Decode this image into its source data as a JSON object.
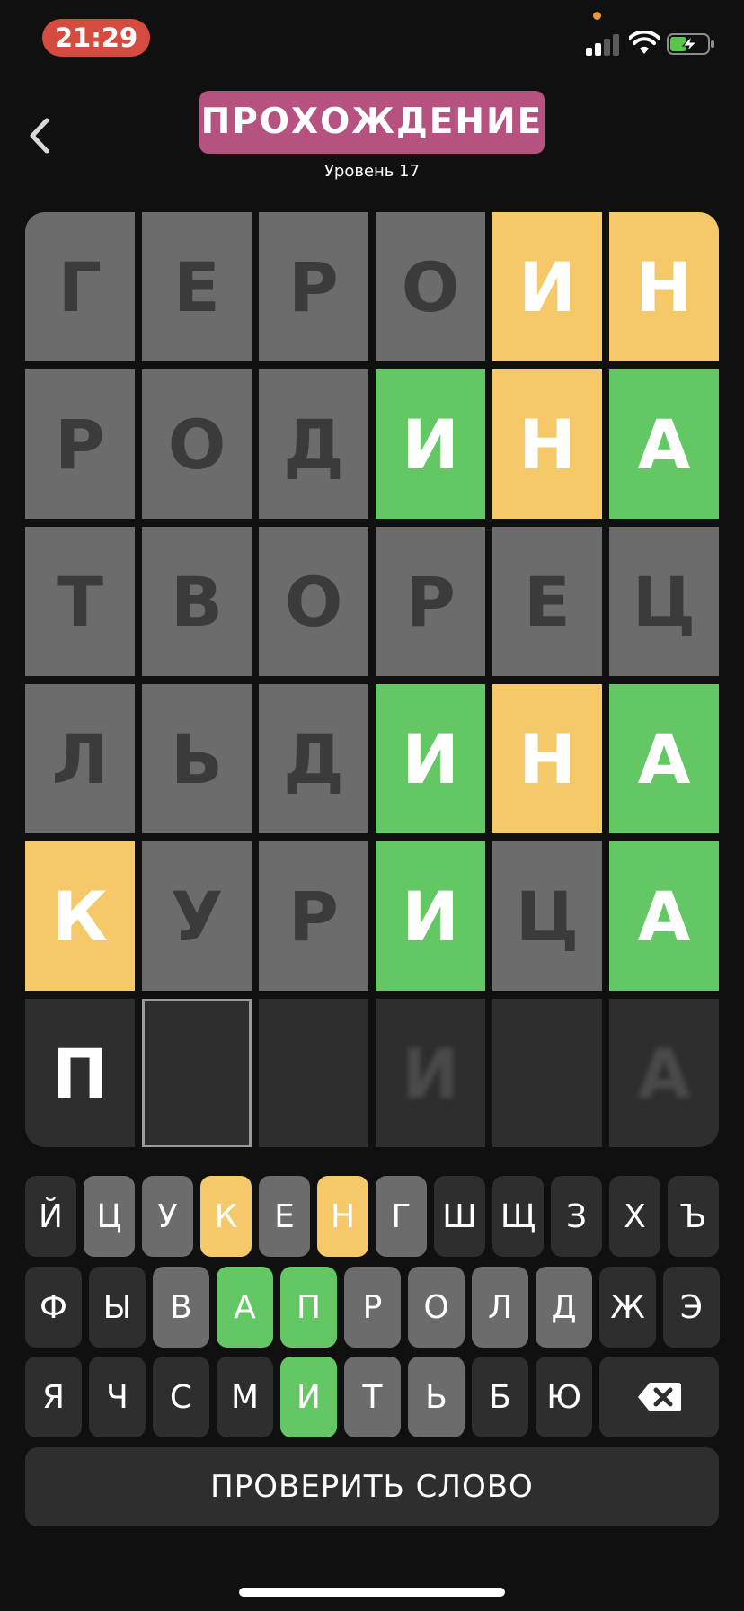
{
  "status": {
    "time": "21:29"
  },
  "header": {
    "title": "ПРОХОЖДЕНИЕ",
    "subtitle": "Уровень 17"
  },
  "colors": {
    "gray": "#6c6c6c",
    "yellow": "#f5c96a",
    "green": "#63c864",
    "empty": "#2e2e2e",
    "title_bg": "#b6527f"
  },
  "icons": {
    "back": "chevron-left-icon",
    "backspace": "backspace-icon"
  },
  "board": {
    "rows": [
      [
        {
          "letter": "Г",
          "state": "gray"
        },
        {
          "letter": "Е",
          "state": "gray"
        },
        {
          "letter": "Р",
          "state": "gray"
        },
        {
          "letter": "О",
          "state": "gray"
        },
        {
          "letter": "И",
          "state": "yellow"
        },
        {
          "letter": "Н",
          "state": "yellow"
        }
      ],
      [
        {
          "letter": "Р",
          "state": "gray"
        },
        {
          "letter": "О",
          "state": "gray"
        },
        {
          "letter": "Д",
          "state": "gray"
        },
        {
          "letter": "И",
          "state": "green"
        },
        {
          "letter": "Н",
          "state": "yellow"
        },
        {
          "letter": "А",
          "state": "green"
        }
      ],
      [
        {
          "letter": "Т",
          "state": "gray"
        },
        {
          "letter": "В",
          "state": "gray"
        },
        {
          "letter": "О",
          "state": "gray"
        },
        {
          "letter": "Р",
          "state": "gray"
        },
        {
          "letter": "Е",
          "state": "gray"
        },
        {
          "letter": "Ц",
          "state": "gray"
        }
      ],
      [
        {
          "letter": "Л",
          "state": "gray"
        },
        {
          "letter": "Ь",
          "state": "gray"
        },
        {
          "letter": "Д",
          "state": "gray"
        },
        {
          "letter": "И",
          "state": "green"
        },
        {
          "letter": "Н",
          "state": "yellow"
        },
        {
          "letter": "А",
          "state": "green"
        }
      ],
      [
        {
          "letter": "К",
          "state": "yellow"
        },
        {
          "letter": "У",
          "state": "gray"
        },
        {
          "letter": "Р",
          "state": "gray"
        },
        {
          "letter": "И",
          "state": "green"
        },
        {
          "letter": "Ц",
          "state": "gray"
        },
        {
          "letter": "А",
          "state": "green"
        }
      ],
      [
        {
          "letter": "П",
          "state": "empty"
        },
        {
          "letter": "",
          "state": "cursor"
        },
        {
          "letter": "",
          "state": "empty"
        },
        {
          "letter": "И",
          "state": "hint"
        },
        {
          "letter": "",
          "state": "empty"
        },
        {
          "letter": "А",
          "state": "hint"
        }
      ]
    ]
  },
  "keyboard": {
    "rows": [
      [
        {
          "k": "Й",
          "s": "dark"
        },
        {
          "k": "Ц",
          "s": "gray"
        },
        {
          "k": "У",
          "s": "gray"
        },
        {
          "k": "К",
          "s": "yellow"
        },
        {
          "k": "Е",
          "s": "gray"
        },
        {
          "k": "Н",
          "s": "yellow"
        },
        {
          "k": "Г",
          "s": "gray"
        },
        {
          "k": "Ш",
          "s": "dark"
        },
        {
          "k": "Щ",
          "s": "dark"
        },
        {
          "k": "З",
          "s": "dark"
        },
        {
          "k": "Х",
          "s": "dark"
        },
        {
          "k": "Ъ",
          "s": "dark"
        }
      ],
      [
        {
          "k": "Ф",
          "s": "dark"
        },
        {
          "k": "Ы",
          "s": "dark"
        },
        {
          "k": "В",
          "s": "gray"
        },
        {
          "k": "А",
          "s": "green"
        },
        {
          "k": "П",
          "s": "green"
        },
        {
          "k": "Р",
          "s": "gray"
        },
        {
          "k": "О",
          "s": "gray"
        },
        {
          "k": "Л",
          "s": "gray"
        },
        {
          "k": "Д",
          "s": "gray"
        },
        {
          "k": "Ж",
          "s": "dark"
        },
        {
          "k": "Э",
          "s": "dark"
        }
      ],
      [
        {
          "k": "Я",
          "s": "dark"
        },
        {
          "k": "Ч",
          "s": "dark"
        },
        {
          "k": "С",
          "s": "dark"
        },
        {
          "k": "М",
          "s": "dark"
        },
        {
          "k": "И",
          "s": "green"
        },
        {
          "k": "Т",
          "s": "gray"
        },
        {
          "k": "Ь",
          "s": "gray"
        },
        {
          "k": "Б",
          "s": "dark"
        },
        {
          "k": "Ю",
          "s": "dark"
        }
      ]
    ]
  },
  "check_button": "ПРОВЕРИТЬ СЛОВО"
}
